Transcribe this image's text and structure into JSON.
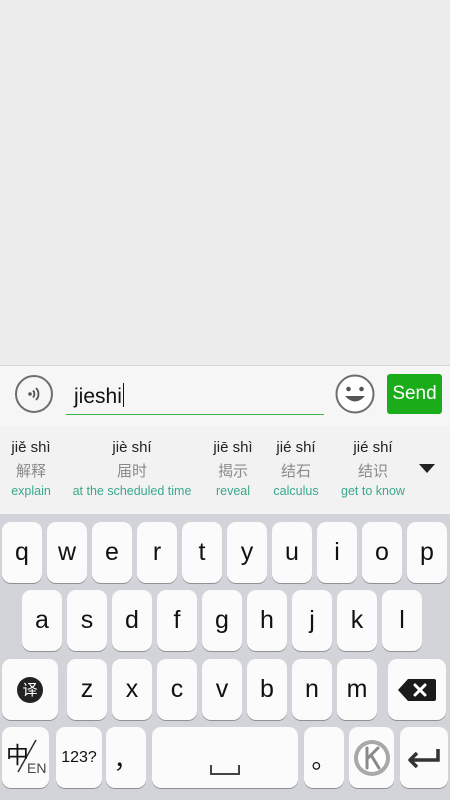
{
  "input": {
    "value": "jieshi",
    "send_label": "Send"
  },
  "candidates": [
    {
      "pinyin": "jiě shì",
      "hanzi": "解释",
      "gloss": "explain"
    },
    {
      "pinyin": "jiè shí",
      "hanzi": "届时",
      "gloss": "at the scheduled time"
    },
    {
      "pinyin": "jiē shì",
      "hanzi": "揭示",
      "gloss": "reveal"
    },
    {
      "pinyin": "jié shí",
      "hanzi": "结石",
      "gloss": "calculus"
    },
    {
      "pinyin": "jié shí",
      "hanzi": "结识",
      "gloss": "get to know"
    }
  ],
  "keyboard": {
    "row1": [
      "q",
      "w",
      "e",
      "r",
      "t",
      "y",
      "u",
      "i",
      "o",
      "p"
    ],
    "row2": [
      "a",
      "s",
      "d",
      "f",
      "g",
      "h",
      "j",
      "k",
      "l"
    ],
    "row3": [
      "z",
      "x",
      "c",
      "v",
      "b",
      "n",
      "m"
    ],
    "translate_key": "译",
    "lang_key": {
      "main": "中",
      "sub": "EN"
    },
    "numbers_key": "123?",
    "comma_key": "，",
    "period_key": "。"
  },
  "colors": {
    "accent_green": "#1aad19",
    "gloss_teal": "#3aa889",
    "keyboard_bg": "#d2d4d9"
  },
  "icons": [
    "voice-icon",
    "emoji-icon",
    "expand-arrow-icon",
    "translate-icon",
    "space-icon",
    "k-logo-icon",
    "backspace-icon",
    "return-icon"
  ]
}
